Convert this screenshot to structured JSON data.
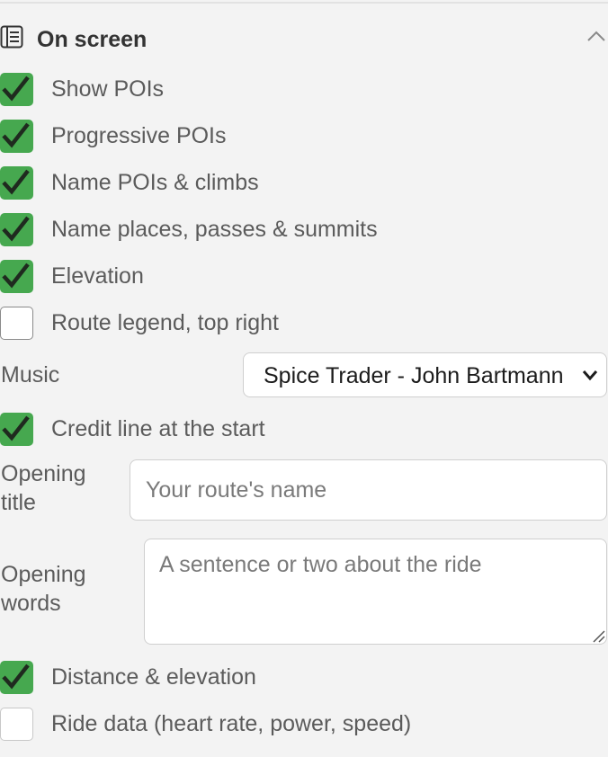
{
  "section": {
    "title": "On screen",
    "icon": "list-panel-icon",
    "collapse_icon": "chevron-up-icon"
  },
  "checkboxes": [
    {
      "label": "Show POIs",
      "checked": true
    },
    {
      "label": "Progressive POIs",
      "checked": true
    },
    {
      "label": "Name POIs & climbs",
      "checked": true
    },
    {
      "label": "Name places, passes & summits",
      "checked": true
    },
    {
      "label": "Elevation",
      "checked": true
    },
    {
      "label": "Route legend, top right",
      "checked": false
    }
  ],
  "music": {
    "label": "Music",
    "selected": "Spice Trader - John Bartmann"
  },
  "credit": {
    "label": "Credit line at the start",
    "checked": true
  },
  "opening_title": {
    "label_line1": "Opening",
    "label_line2": "title",
    "value": "",
    "placeholder": "Your route's name"
  },
  "opening_words": {
    "label_line1": "Opening",
    "label_line2": "words",
    "value": "",
    "placeholder": "A sentence or two about the ride"
  },
  "distance": {
    "label": "Distance & elevation",
    "checked": true
  },
  "ride_data": {
    "label": "Ride data (heart rate, power, speed)",
    "checked": false
  },
  "colors": {
    "accent_green": "#46a84f",
    "background": "#f3f3f3",
    "text": "#5b5b5b"
  }
}
